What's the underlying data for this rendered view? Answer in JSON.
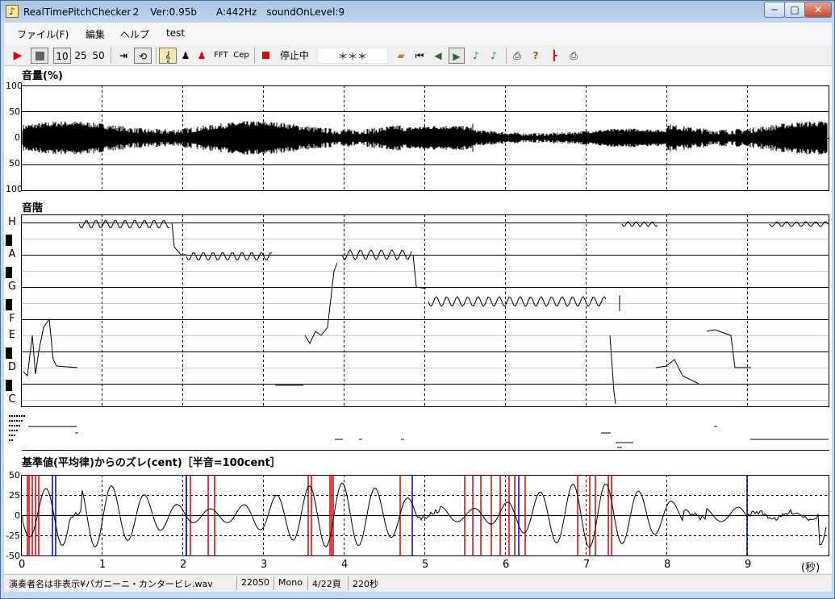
{
  "window": {
    "title": "RealTimePitchChecker２　Ver:0.95b　　A:442Hz　soundOnLevel:9"
  },
  "menu": [
    "ファイル(F)",
    "編集",
    "ヘルプ",
    "test"
  ],
  "toolbar": {
    "speed_options": [
      "10",
      "25",
      "50"
    ],
    "fft_label": "FFT",
    "cep_label": "Cep",
    "status_text": "停止中",
    "pitch_display": "＊＊＊"
  },
  "volume_panel": {
    "title": "音量(%)",
    "y_labels": [
      "100",
      "50",
      "0",
      "50",
      "100"
    ]
  },
  "scale_panel": {
    "title": "音階",
    "notes": [
      "H",
      "A",
      "G",
      "F",
      "E",
      "D",
      "C"
    ]
  },
  "deviation_panel": {
    "title": "基準値(平均律)からのズレ(cent)［半音=100cent］",
    "y_labels": [
      "50",
      "25",
      "0",
      "-25",
      "-50"
    ]
  },
  "time_axis": {
    "ticks": [
      "0",
      "1",
      "2",
      "3",
      "4",
      "5",
      "6",
      "7",
      "8",
      "9"
    ],
    "unit": "(秒)"
  },
  "status": {
    "file": "演奏者名は非表示¥パガニーニ・カンタービレ.wav",
    "sample_rate": "22050",
    "channels": "Mono",
    "page": "4/22頁",
    "duration": "220秒"
  },
  "colors": {
    "deviation_red": "#e00000",
    "deviation_blue": "#0000c8",
    "stop_red": "#e00000"
  }
}
